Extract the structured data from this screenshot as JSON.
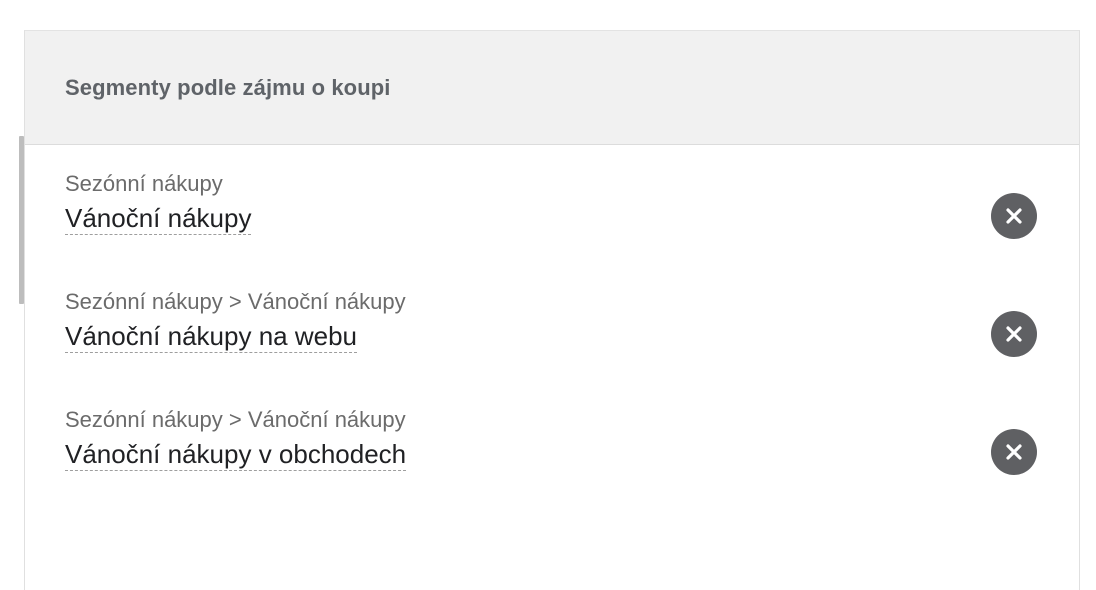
{
  "panel": {
    "title": "Segmenty podle zájmu o koupi"
  },
  "items": [
    {
      "path": "Sezónní nákupy",
      "name": "Vánoční nákupy",
      "remove_icon": "close-circle-icon"
    },
    {
      "path": "Sezónní nákupy > Vánoční nákupy",
      "name": "Vánoční nákupy na webu",
      "remove_icon": "close-circle-icon"
    },
    {
      "path": "Sezónní nákupy > Vánoční nákupy",
      "name": "Vánoční nákupy v obchodech",
      "remove_icon": "close-circle-icon"
    }
  ],
  "colors": {
    "header_bg": "#f1f1f1",
    "remove_button": "#5f6063",
    "name_text": "#202124",
    "path_text": "#6b6b6b"
  }
}
